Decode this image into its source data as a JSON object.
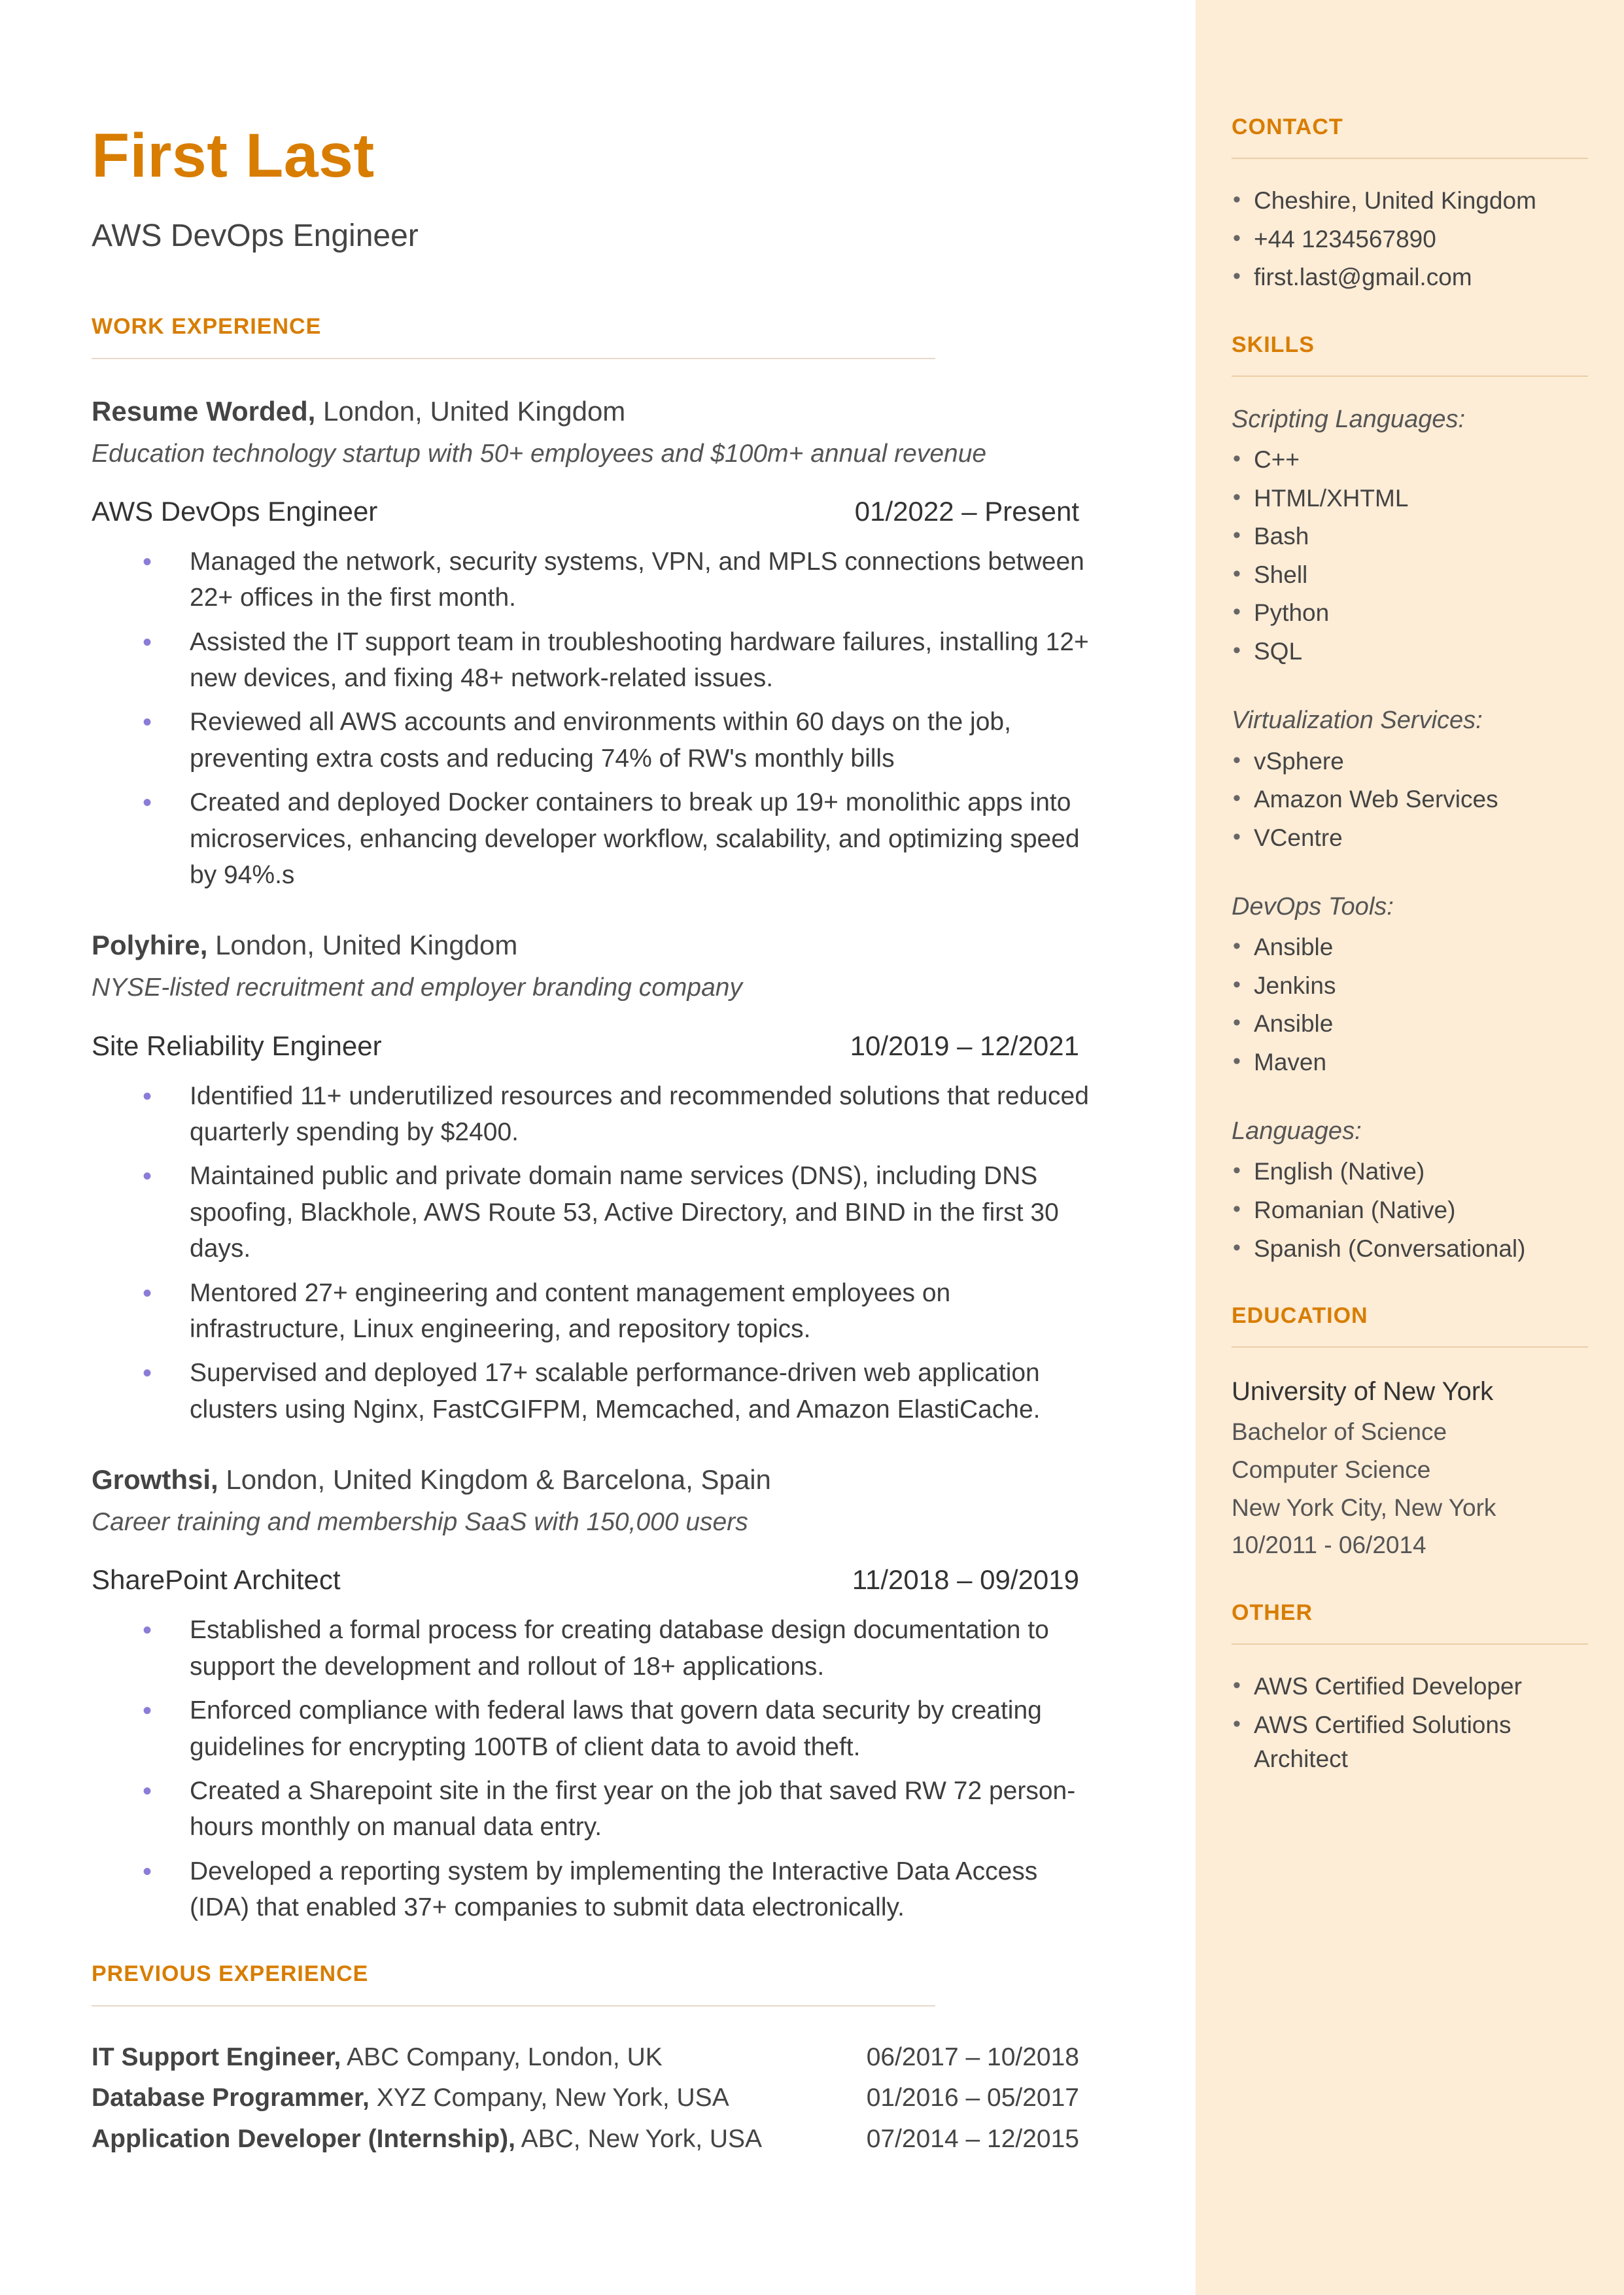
{
  "header": {
    "name": "First Last",
    "title": "AWS DevOps Engineer"
  },
  "sections": {
    "work": "WORK EXPERIENCE",
    "previous": "PREVIOUS EXPERIENCE",
    "contact": "CONTACT",
    "skills": "SKILLS",
    "education": "EDUCATION",
    "other": "OTHER"
  },
  "jobs": [
    {
      "company": "Resume Worded,",
      "location": " London, United Kingdom",
      "desc": "Education technology startup with 50+ employees and $100m+ annual revenue",
      "role": "AWS DevOps Engineer",
      "dates": "01/2022 – Present",
      "bullets": [
        "Managed the network, security systems, VPN, and MPLS connections between 22+ offices in the first month.",
        "Assisted the IT support team in troubleshooting hardware failures, installing 12+ new devices, and fixing 48+ network-related issues.",
        "Reviewed all AWS accounts and environments within 60 days on the job, preventing extra costs and reducing 74% of RW's monthly bills",
        "Created and deployed Docker containers to break up 19+ monolithic apps into microservices, enhancing developer workflow, scalability, and optimizing speed by 94%.s"
      ]
    },
    {
      "company": "Polyhire,",
      "location": " London, United Kingdom",
      "desc": "NYSE-listed recruitment and employer branding company",
      "role": "Site Reliability Engineer",
      "dates": "10/2019 – 12/2021",
      "bullets": [
        "Identified 11+ underutilized resources and recommended solutions that reduced quarterly spending by $2400.",
        "Maintained public and private domain name services (DNS), including DNS spoofing, Blackhole, AWS Route 53, Active Directory, and BIND in the first 30 days.",
        "Mentored 27+ engineering and content management employees on infrastructure, Linux engineering, and repository topics.",
        "Supervised and deployed 17+ scalable performance-driven web application clusters using Nginx, FastCGIFPM, Memcached, and Amazon ElastiCache."
      ]
    },
    {
      "company": "Growthsi,",
      "location": " London, United Kingdom & Barcelona, Spain",
      "desc": "Career training and membership SaaS with 150,000 users",
      "role": "SharePoint Architect",
      "dates": "11/2018 – 09/2019",
      "bullets": [
        "Established a formal process for creating database design documentation to support the development and rollout of 18+ applications.",
        "Enforced compliance with federal laws that govern data security by creating guidelines for encrypting 100TB of client data to avoid theft.",
        "Created a Sharepoint site in the first year on the job that saved RW 72 person-hours monthly on manual data entry.",
        "Developed a reporting system by implementing the Interactive Data Access (IDA) that enabled 37+ companies to submit data electronically."
      ]
    }
  ],
  "previous": [
    {
      "title": "IT Support Engineer,",
      "loc": " ABC Company, London, UK",
      "dates": "06/2017 – 10/2018"
    },
    {
      "title": "Database Programmer,",
      "loc": " XYZ Company, New York, USA",
      "dates": "01/2016 – 05/2017"
    },
    {
      "title": "Application Developer (Internship),",
      "loc": " ABC, New York, USA",
      "dates": "07/2014 – 12/2015"
    }
  ],
  "contact": [
    "Cheshire, United Kingdom",
    "+44 1234567890",
    "first.last@gmail.com"
  ],
  "skills": {
    "groups": [
      {
        "title": "Scripting Languages:",
        "items": [
          "C++",
          "HTML/XHTML",
          "Bash",
          "Shell",
          "Python",
          "SQL"
        ]
      },
      {
        "title": "Virtualization Services:",
        "items": [
          "vSphere",
          "Amazon Web Services",
          "VCentre"
        ]
      },
      {
        "title": "DevOps Tools:",
        "items": [
          "Ansible",
          "Jenkins",
          "Ansible",
          "Maven"
        ]
      },
      {
        "title": "Languages:",
        "items": [
          "English (Native)",
          "Romanian (Native)",
          "Spanish (Conversational)"
        ]
      }
    ]
  },
  "education": {
    "uni": "University of New York",
    "deg": "Bachelor of Science",
    "field": "Computer Science",
    "loc": "New York City, New York",
    "dates": "10/2011 - 06/2014"
  },
  "other": [
    "AWS Certified Developer",
    "AWS Certified Solutions Architect"
  ]
}
